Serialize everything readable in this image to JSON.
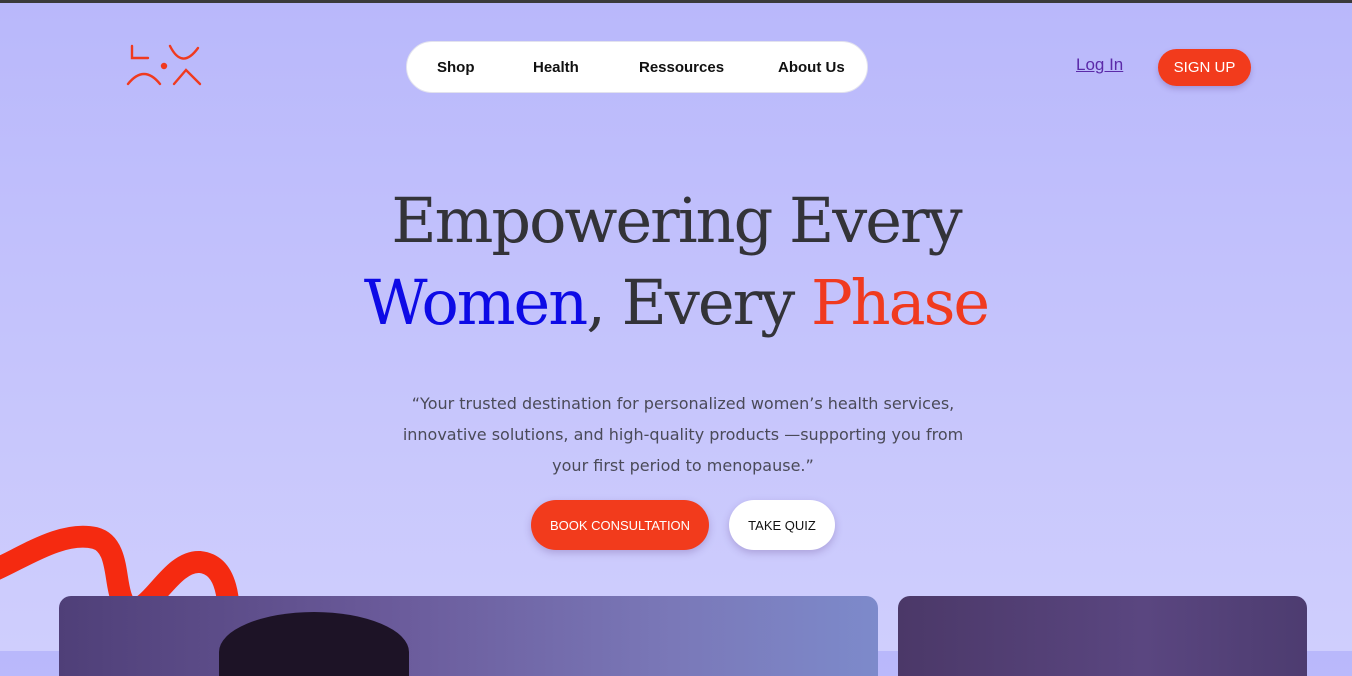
{
  "nav": {
    "items": [
      {
        "label": "Shop",
        "name": "nav-shop"
      },
      {
        "label": "Health",
        "name": "nav-health"
      },
      {
        "label": "Ressources",
        "name": "nav-resources"
      },
      {
        "label": "About Us",
        "name": "nav-about-us"
      }
    ]
  },
  "auth": {
    "login_label": "Log In",
    "signup_label": "SIGN UP"
  },
  "hero": {
    "line1": "Empowering Every",
    "line2_blue": "Women",
    "line2_mid": ", Every ",
    "line2_red": "Phase",
    "subtitle": "“Your trusted destination for personalized women’s health services, innovative solutions, and high-quality products —supporting you from your first period to menopause.”",
    "cta_primary": "BOOK CONSULTATION",
    "cta_secondary": "TAKE QUIZ"
  },
  "colors": {
    "accent_red": "#f23b1c",
    "accent_blue": "#0d0ae6",
    "background": "#bdbcfb",
    "link_purple": "#5b2aa8"
  },
  "icons": {
    "logo": "brand-logo-icon",
    "decoration": "red-squiggle-decoration"
  }
}
